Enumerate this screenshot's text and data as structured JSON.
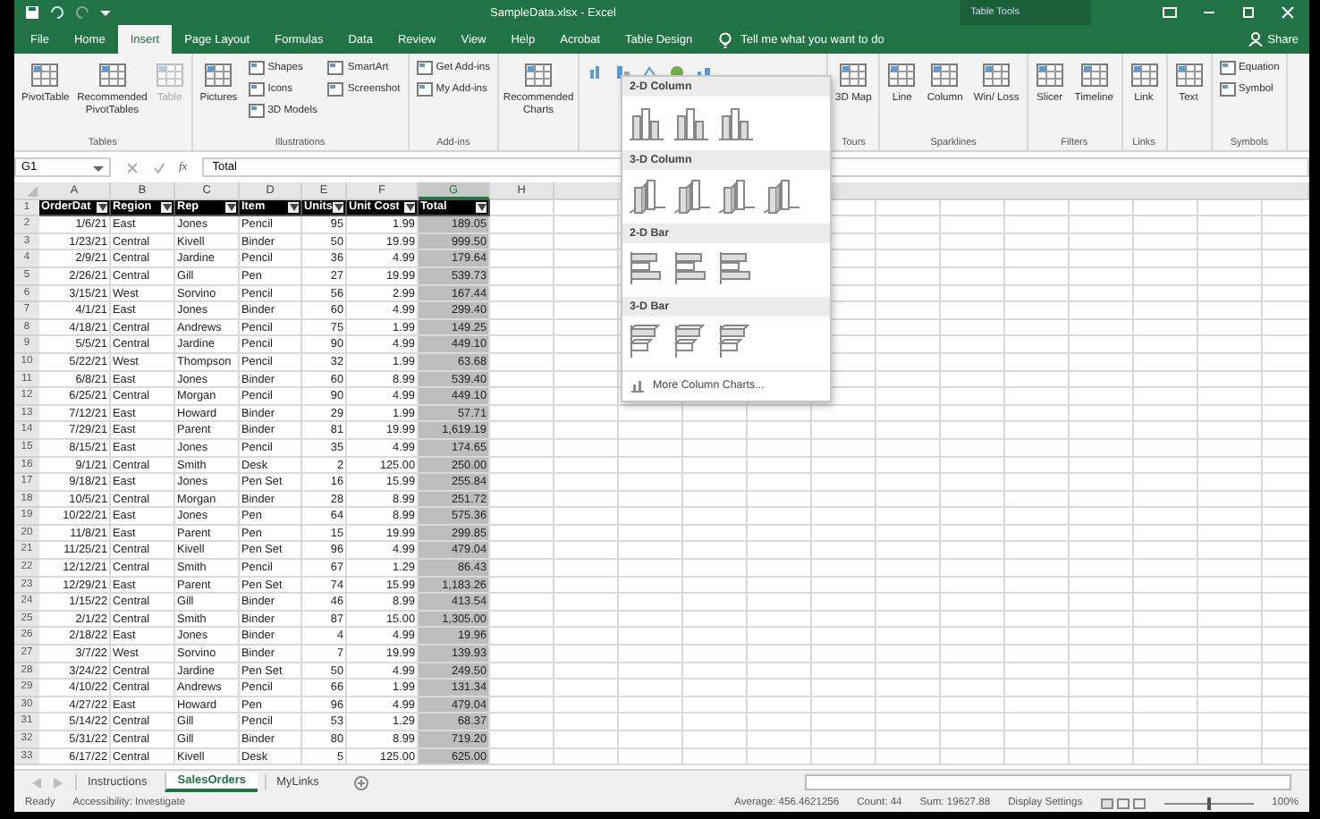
{
  "window": {
    "title": "SampleData.xlsx - Excel",
    "context_title": "Table Tools"
  },
  "tabs": [
    {
      "label": "File",
      "selected": false
    },
    {
      "label": "Home",
      "selected": false
    },
    {
      "label": "Insert",
      "selected": true
    },
    {
      "label": "Page Layout",
      "selected": false
    },
    {
      "label": "Formulas",
      "selected": false
    },
    {
      "label": "Data",
      "selected": false
    },
    {
      "label": "Review",
      "selected": false
    },
    {
      "label": "View",
      "selected": false
    },
    {
      "label": "Help",
      "selected": false
    },
    {
      "label": "Acrobat",
      "selected": false
    },
    {
      "label": "Table Design",
      "selected": false
    }
  ],
  "tell_me": "Tell me what you want to do",
  "share": "Share",
  "ribbon": [
    {
      "kind": "buttons",
      "label": "Tables",
      "items": [
        {
          "kind": "large",
          "label": "PivotTable",
          "disabled": false
        },
        {
          "kind": "large",
          "label": "Recommended PivotTables",
          "disabled": false
        },
        {
          "kind": "large",
          "label": "Table",
          "disabled": true
        }
      ]
    },
    {
      "kind": "buttons",
      "label": "Illustrations",
      "items": [
        {
          "kind": "large",
          "label": "Pictures",
          "disabled": false
        },
        {
          "kind": "small",
          "label": "Shapes",
          "disabled": false
        },
        {
          "kind": "small",
          "label": "Icons",
          "disabled": false
        },
        {
          "kind": "small",
          "label": "3D Models",
          "disabled": false
        },
        {
          "kind": "small",
          "label": "SmartArt",
          "disabled": false
        },
        {
          "kind": "small",
          "label": "Screenshot",
          "disabled": false
        }
      ]
    },
    {
      "kind": "buttons",
      "label": "Add-ins",
      "items": [
        {
          "kind": "small",
          "label": "Get Add-ins",
          "disabled": false
        },
        {
          "kind": "small",
          "label": "My Add-ins",
          "disabled": false
        }
      ]
    },
    {
      "kind": "buttons",
      "items": [
        {
          "kind": "large",
          "label": "Recommended Charts",
          "disabled": false
        }
      ]
    },
    {
      "kind": "charts"
    },
    {
      "kind": "buttons",
      "label": "Tours",
      "items": [
        {
          "kind": "large",
          "label": "3D Map",
          "disabled": false
        }
      ]
    },
    {
      "kind": "buttons",
      "label": "Sparklines",
      "items": [
        {
          "kind": "large",
          "label": "Line",
          "disabled": false
        },
        {
          "kind": "large",
          "label": "Column",
          "disabled": false
        },
        {
          "kind": "large",
          "label": "Win/ Loss",
          "disabled": false
        }
      ]
    },
    {
      "kind": "buttons",
      "label": "Filters",
      "items": [
        {
          "kind": "large",
          "label": "Slicer",
          "disabled": false
        },
        {
          "kind": "large",
          "label": "Timeline",
          "disabled": false
        }
      ]
    },
    {
      "kind": "buttons",
      "label": "Links",
      "items": [
        {
          "kind": "large",
          "label": "Link",
          "disabled": false
        }
      ]
    },
    {
      "kind": "buttons",
      "items": [
        {
          "kind": "large",
          "label": "Text",
          "disabled": false
        }
      ]
    },
    {
      "kind": "buttons",
      "label": "Symbols",
      "items": [
        {
          "kind": "small",
          "label": "Equation",
          "disabled": false
        },
        {
          "kind": "small",
          "label": "Symbol",
          "disabled": false
        }
      ]
    }
  ],
  "name_box": "G1",
  "fx_label": "fx",
  "formula": "Total",
  "sheet": {
    "columns": [
      {
        "letter": "A",
        "selected": false
      },
      {
        "letter": "B",
        "selected": false
      },
      {
        "letter": "C",
        "selected": false
      },
      {
        "letter": "D",
        "selected": false
      },
      {
        "letter": "E",
        "selected": false
      },
      {
        "letter": "F",
        "selected": false
      },
      {
        "letter": "G",
        "selected": true
      },
      {
        "letter": "H",
        "selected": false
      }
    ],
    "header": {
      "row_number": "1",
      "cells": [
        "OrderDat",
        "Region",
        "Rep",
        "Item",
        "Units",
        "Unit Cost",
        "Total"
      ]
    },
    "rows": [
      {
        "row_number": "2",
        "cells": [
          "1/6/21",
          "East",
          "Jones",
          "Pencil",
          "95",
          "1.99",
          "189.05"
        ]
      },
      {
        "row_number": "3",
        "cells": [
          "1/23/21",
          "Central",
          "Kivell",
          "Binder",
          "50",
          "19.99",
          "999.50"
        ]
      },
      {
        "row_number": "4",
        "cells": [
          "2/9/21",
          "Central",
          "Jardine",
          "Pencil",
          "36",
          "4.99",
          "179.64"
        ]
      },
      {
        "row_number": "5",
        "cells": [
          "2/26/21",
          "Central",
          "Gill",
          "Pen",
          "27",
          "19.99",
          "539.73"
        ]
      },
      {
        "row_number": "6",
        "cells": [
          "3/15/21",
          "West",
          "Sorvino",
          "Pencil",
          "56",
          "2.99",
          "167.44"
        ]
      },
      {
        "row_number": "7",
        "cells": [
          "4/1/21",
          "East",
          "Jones",
          "Binder",
          "60",
          "4.99",
          "299.40"
        ]
      },
      {
        "row_number": "8",
        "cells": [
          "4/18/21",
          "Central",
          "Andrews",
          "Pencil",
          "75",
          "1.99",
          "149.25"
        ]
      },
      {
        "row_number": "9",
        "cells": [
          "5/5/21",
          "Central",
          "Jardine",
          "Pencil",
          "90",
          "4.99",
          "449.10"
        ]
      },
      {
        "row_number": "10",
        "cells": [
          "5/22/21",
          "West",
          "Thompson",
          "Pencil",
          "32",
          "1.99",
          "63.68"
        ]
      },
      {
        "row_number": "11",
        "cells": [
          "6/8/21",
          "East",
          "Jones",
          "Binder",
          "60",
          "8.99",
          "539.40"
        ]
      },
      {
        "row_number": "12",
        "cells": [
          "6/25/21",
          "Central",
          "Morgan",
          "Pencil",
          "90",
          "4.99",
          "449.10"
        ]
      },
      {
        "row_number": "13",
        "cells": [
          "7/12/21",
          "East",
          "Howard",
          "Binder",
          "29",
          "1.99",
          "57.71"
        ]
      },
      {
        "row_number": "14",
        "cells": [
          "7/29/21",
          "East",
          "Parent",
          "Binder",
          "81",
          "19.99",
          "1,619.19"
        ]
      },
      {
        "row_number": "15",
        "cells": [
          "8/15/21",
          "East",
          "Jones",
          "Pencil",
          "35",
          "4.99",
          "174.65"
        ]
      },
      {
        "row_number": "16",
        "cells": [
          "9/1/21",
          "Central",
          "Smith",
          "Desk",
          "2",
          "125.00",
          "250.00"
        ]
      },
      {
        "row_number": "17",
        "cells": [
          "9/18/21",
          "East",
          "Jones",
          "Pen Set",
          "16",
          "15.99",
          "255.84"
        ]
      },
      {
        "row_number": "18",
        "cells": [
          "10/5/21",
          "Central",
          "Morgan",
          "Binder",
          "28",
          "8.99",
          "251.72"
        ]
      },
      {
        "row_number": "19",
        "cells": [
          "10/22/21",
          "East",
          "Jones",
          "Pen",
          "64",
          "8.99",
          "575.36"
        ]
      },
      {
        "row_number": "20",
        "cells": [
          "11/8/21",
          "East",
          "Parent",
          "Pen",
          "15",
          "19.99",
          "299.85"
        ]
      },
      {
        "row_number": "21",
        "cells": [
          "11/25/21",
          "Central",
          "Kivell",
          "Pen Set",
          "96",
          "4.99",
          "479.04"
        ]
      },
      {
        "row_number": "22",
        "cells": [
          "12/12/21",
          "Central",
          "Smith",
          "Pencil",
          "67",
          "1.29",
          "86.43"
        ]
      },
      {
        "row_number": "23",
        "cells": [
          "12/29/21",
          "East",
          "Parent",
          "Pen Set",
          "74",
          "15.99",
          "1,183.26"
        ]
      },
      {
        "row_number": "24",
        "cells": [
          "1/15/22",
          "Central",
          "Gill",
          "Binder",
          "46",
          "8.99",
          "413.54"
        ]
      },
      {
        "row_number": "25",
        "cells": [
          "2/1/22",
          "Central",
          "Smith",
          "Binder",
          "87",
          "15.00",
          "1,305.00"
        ]
      },
      {
        "row_number": "26",
        "cells": [
          "2/18/22",
          "East",
          "Jones",
          "Binder",
          "4",
          "4.99",
          "19.96"
        ]
      },
      {
        "row_number": "27",
        "cells": [
          "3/7/22",
          "West",
          "Sorvino",
          "Binder",
          "7",
          "19.99",
          "139.93"
        ]
      },
      {
        "row_number": "28",
        "cells": [
          "3/24/22",
          "Central",
          "Jardine",
          "Pen Set",
          "50",
          "4.99",
          "249.50"
        ]
      },
      {
        "row_number": "29",
        "cells": [
          "4/10/22",
          "Central",
          "Andrews",
          "Pencil",
          "66",
          "1.99",
          "131.34"
        ]
      },
      {
        "row_number": "30",
        "cells": [
          "4/27/22",
          "East",
          "Howard",
          "Pen",
          "96",
          "4.99",
          "479.04"
        ]
      },
      {
        "row_number": "31",
        "cells": [
          "5/14/22",
          "Central",
          "Gill",
          "Pencil",
          "53",
          "1.29",
          "68.37"
        ]
      },
      {
        "row_number": "32",
        "cells": [
          "5/31/22",
          "Central",
          "Gill",
          "Binder",
          "80",
          "8.99",
          "719.20"
        ]
      },
      {
        "row_number": "33",
        "cells": [
          "6/17/22",
          "Central",
          "Kivell",
          "Desk",
          "5",
          "125.00",
          "625.00"
        ]
      }
    ]
  },
  "chart_menu": {
    "sections": [
      {
        "title": "2-D Column",
        "kind": "column2d"
      },
      {
        "title": "3-D Column",
        "kind": "column3d"
      },
      {
        "title": "2-D Bar",
        "kind": "bar2d"
      },
      {
        "title": "3-D Bar",
        "kind": "bar3d"
      }
    ],
    "more": "More Column Charts..."
  },
  "sheet_tabs": [
    {
      "label": "Instructions",
      "selected": false
    },
    {
      "label": "SalesOrders",
      "selected": true
    },
    {
      "label": "MyLinks",
      "selected": false
    }
  ],
  "status_bar": {
    "left": [
      "Ready",
      "Accessibility: Investigate"
    ],
    "right": [
      "Average: 456.4621256",
      "Count: 44",
      "Sum: 19627.88",
      "Display Settings"
    ],
    "zoom": "100%",
    "zoom_slider": {
      "level": 0.5
    }
  }
}
